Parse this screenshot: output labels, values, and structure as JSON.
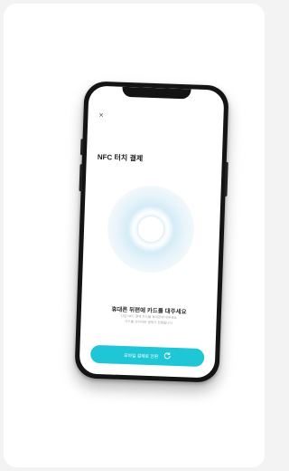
{
  "screen": {
    "close_label": "×",
    "title": "NFC 터치 결제",
    "instruction": "휴대폰 뒤편에 카드를 대주세요",
    "sub_lines": [
      "다날 NFC 결제 카드를 휴대폰에 대주세요",
      "카드를 인식하면 결제가 진행됩니다"
    ],
    "cta_label": "모바일 결제로 전환",
    "cta_icon": "refresh-icon"
  },
  "colors": {
    "accent": "#1ec6d6",
    "ripple": "#d5ecf7",
    "frame": "#141414"
  }
}
